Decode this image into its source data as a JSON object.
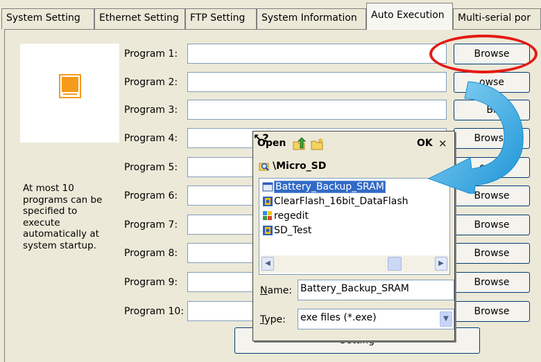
{
  "tabs": [
    {
      "label": "System Setting"
    },
    {
      "label": "Ethernet Setting"
    },
    {
      "label": "FTP Setting"
    },
    {
      "label": "System Information"
    },
    {
      "label": "Auto Execution",
      "active": true
    },
    {
      "label": "Multi-serial por"
    }
  ],
  "description": "At most 10\nprograms can be\nspecified to\nexecute\nautomatically at\nsystem startup.",
  "programs": [
    {
      "label": "Program 1:",
      "value": "",
      "browse": "Browse"
    },
    {
      "label": "Program 2:",
      "value": "",
      "browse": "owse"
    },
    {
      "label": "Program 3:",
      "value": "",
      "browse": "Br"
    },
    {
      "label": "Program 4:",
      "value": "",
      "browse": "Browse"
    },
    {
      "label": "Program 5:",
      "value": "",
      "browse": "owse"
    },
    {
      "label": "Program 6:",
      "value": "",
      "browse": "Browse"
    },
    {
      "label": "Program 7:",
      "value": "",
      "browse": "Browse"
    },
    {
      "label": "Program 8:",
      "value": "",
      "browse": "Browse"
    },
    {
      "label": "Program 9:",
      "value": "",
      "browse": "Browse"
    },
    {
      "label": "Program 10:",
      "value": "",
      "browse": "Browse"
    }
  ],
  "setting_button": "Setting",
  "dialog": {
    "title": "Open",
    "help": "?",
    "ok": "OK",
    "close": "×",
    "path": "\\Micro_SD",
    "files": [
      {
        "name": "Battery_Backup_SRAM",
        "icon": "exe-window-icon",
        "selected": true
      },
      {
        "name": "ClearFlash_16bit_DataFlash",
        "icon": "exe-app-icon"
      },
      {
        "name": "regedit",
        "icon": "regedit-icon"
      },
      {
        "name": "SD_Test",
        "icon": "exe-app-icon"
      }
    ],
    "name_label_u": "N",
    "name_label_rest": "ame:",
    "name_value": "Battery_Backup_SRAM",
    "type_label_u": "T",
    "type_label_rest": "ype:",
    "type_value": "exe files (*.exe)"
  },
  "colors": {
    "accent_orange": "#f59a1a",
    "callout_red": "#e41b13",
    "callout_arrow": "#29a8e0",
    "selection": "#316ac5"
  }
}
